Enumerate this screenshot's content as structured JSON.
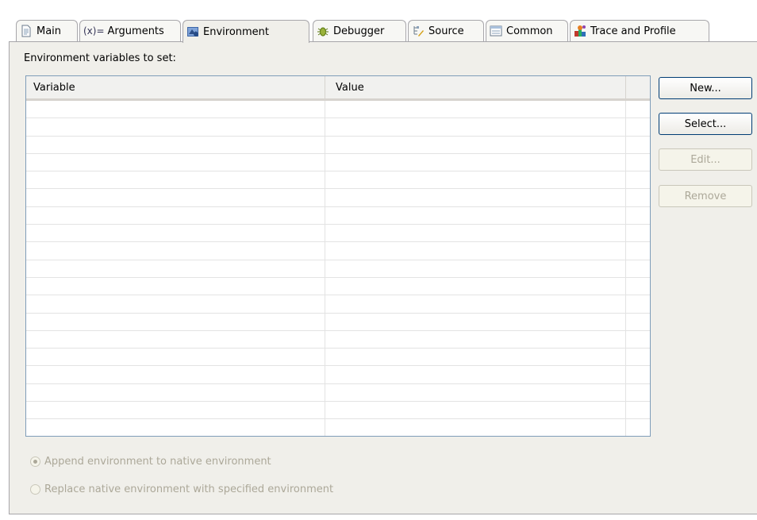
{
  "tabs": [
    {
      "label": "Main",
      "icon": "main-page-icon"
    },
    {
      "label": "Arguments",
      "icon": "arguments-icon",
      "prefix": "(x)="
    },
    {
      "label": "Environment",
      "icon": "environment-icon"
    },
    {
      "label": "Debugger",
      "icon": "debugger-bug-icon"
    },
    {
      "label": "Source",
      "icon": "source-icon"
    },
    {
      "label": "Common",
      "icon": "common-icon"
    },
    {
      "label": "Trace and Profile",
      "icon": "trace-profile-icon"
    }
  ],
  "active_tab": "Environment",
  "heading": "Environment variables to set:",
  "table": {
    "columns": [
      "Variable",
      "Value"
    ],
    "rows": []
  },
  "buttons": {
    "new": "New...",
    "select": "Select...",
    "edit": "Edit...",
    "remove": "Remove"
  },
  "options": {
    "append": "Append environment to native environment",
    "replace": "Replace native environment with specified environment",
    "selected": "append"
  }
}
